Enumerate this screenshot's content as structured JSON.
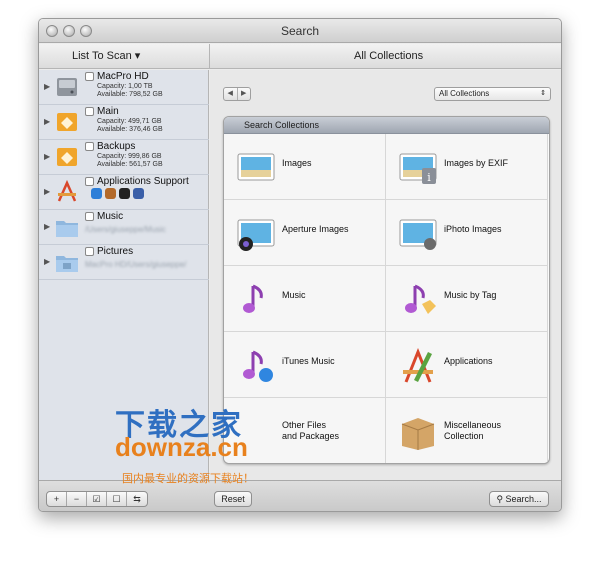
{
  "window": {
    "title": "Search"
  },
  "toolbar": {
    "list_menu": "List To Scan ▾",
    "column_title": "All Collections"
  },
  "sidebar": {
    "items": [
      {
        "name": "MacPro HD",
        "capacity": "Capacity: 1,00 TB",
        "available": "Available: 798,52 GB"
      },
      {
        "name": "Main",
        "capacity": "Capacity: 499,71 GB",
        "available": "Available: 376,46 GB"
      },
      {
        "name": "Backups",
        "capacity": "Capacity: 999,86 GB",
        "available": "Available: 561,57 GB"
      },
      {
        "name": "Applications Support"
      },
      {
        "name": "Music",
        "path": "/Users/giuseppe/Music"
      },
      {
        "name": "Pictures",
        "path": "MacPro HD/Users/giuseppe/"
      }
    ]
  },
  "main": {
    "nav_back": "◀",
    "nav_forward": "▶",
    "select_value": "All Collections",
    "panel_title": "Search Collections",
    "collections": [
      "Images",
      "Images by EXIF",
      "Aperture Images",
      "iPhoto Images",
      "Music",
      "Music by Tag",
      "iTunes Music",
      "Applications",
      "Other Files\nand Packages",
      "Miscellaneous\nCollection"
    ]
  },
  "watermark": {
    "line1": "下载之家",
    "line2": "downza.cn",
    "line3": "国内最专业的资源下载站！"
  },
  "bottom": {
    "seg": [
      "+",
      "−",
      "☑",
      "☐",
      "⇆"
    ],
    "reset": "Reset",
    "search": "Search..."
  }
}
